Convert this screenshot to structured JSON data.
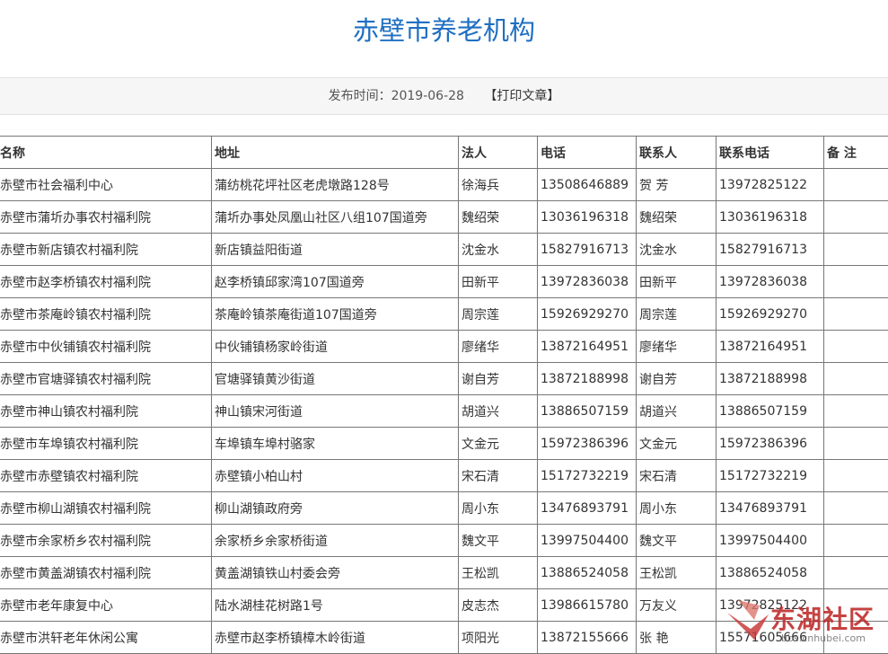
{
  "article": {
    "title": "赤壁市养老机构",
    "publish_label": "发布时间：",
    "publish_date": "2019-06-28",
    "print_link": "【打印文章】"
  },
  "table": {
    "headers": [
      "名称",
      "地址",
      "法人",
      "电话",
      "联系人",
      "联系电话",
      "备  注"
    ],
    "rows": [
      [
        "赤壁市社会福利中心",
        "蒲纺桃花坪社区老虎墩路128号",
        "徐海兵",
        "13508646889",
        "贺  芳",
        "13972825122",
        ""
      ],
      [
        "赤壁市蒲圻办事农村福利院",
        "蒲圻办事处凤凰山社区八组107国道旁",
        "魏绍荣",
        "13036196318",
        "魏绍荣",
        "13036196318",
        ""
      ],
      [
        "赤壁市新店镇农村福利院",
        "新店镇益阳街道",
        "沈金水",
        "15827916713",
        "沈金水",
        "15827916713",
        ""
      ],
      [
        "赤壁市赵李桥镇农村福利院",
        "赵李桥镇邱家湾107国道旁",
        "田新平",
        "13972836038",
        "田新平",
        "13972836038",
        ""
      ],
      [
        "赤壁市茶庵岭镇农村福利院",
        "茶庵岭镇茶庵街道107国道旁",
        "周宗莲",
        "15926929270",
        "周宗莲",
        "15926929270",
        ""
      ],
      [
        "赤壁市中伙铺镇农村福利院",
        "中伙铺镇杨家岭街道",
        "廖绪华",
        "13872164951",
        "廖绪华",
        "13872164951",
        ""
      ],
      [
        "赤壁市官塘驿镇农村福利院",
        "官塘驿镇黄沙街道",
        "谢自芳",
        "13872188998",
        "谢自芳",
        "13872188998",
        ""
      ],
      [
        "赤壁市神山镇农村福利院",
        "神山镇宋河街道",
        "胡道兴",
        "13886507159",
        "胡道兴",
        "13886507159",
        ""
      ],
      [
        "赤壁市车埠镇农村福利院",
        "车埠镇车埠村骆家",
        "文金元",
        "15972386396",
        "文金元",
        "15972386396",
        ""
      ],
      [
        "赤壁市赤壁镇农村福利院",
        "赤壁镇小柏山村",
        "宋石清",
        "15172732219",
        "宋石清",
        "15172732219",
        ""
      ],
      [
        "赤壁市柳山湖镇农村福利院",
        "柳山湖镇政府旁",
        "周小东",
        "13476893791",
        "周小东",
        "13476893791",
        ""
      ],
      [
        "赤壁市余家桥乡农村福利院",
        "余家桥乡余家桥街道",
        "魏文平",
        "13997504400",
        "魏文平",
        "13997504400",
        ""
      ],
      [
        "赤壁市黄盖湖镇农村福利院",
        "黄盖湖镇铁山村委会旁",
        "王松凯",
        "13886524058",
        "王松凯",
        "13886524058",
        ""
      ],
      [
        "赤壁市老年康复中心",
        "陆水湖桂花树路1号",
        "皮志杰",
        "13986615780",
        "万友义",
        "13972825122",
        ""
      ],
      [
        "赤壁市洪轩老年休闲公寓",
        "赤壁市赵李桥镇樟木岭街道",
        "项阳光",
        "13872155666",
        "张  艳",
        "15571605666",
        ""
      ]
    ]
  },
  "watermark": {
    "brand": "东湖社区",
    "url": "bbs.cnhubei.com",
    "color": "#c02828"
  }
}
